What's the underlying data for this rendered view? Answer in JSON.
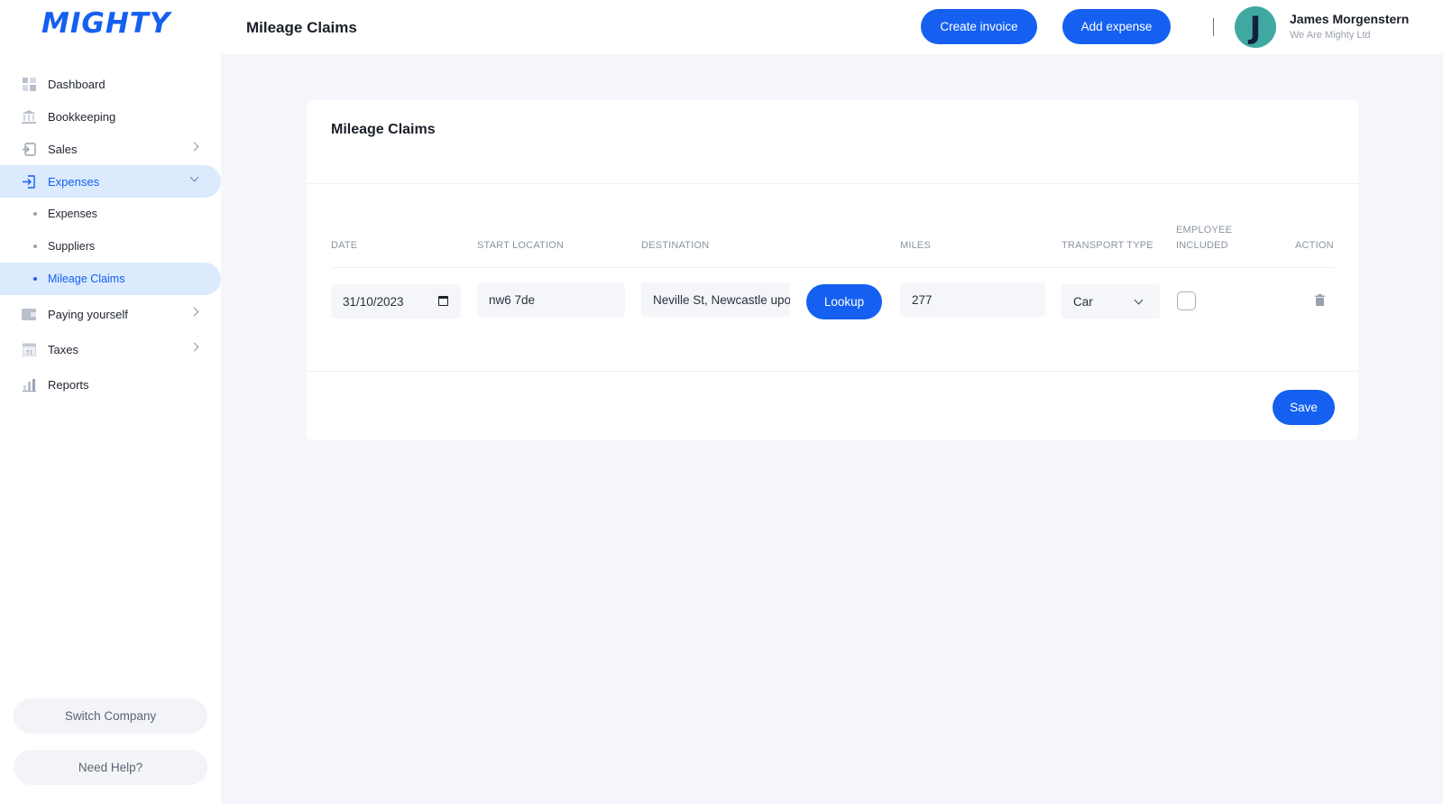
{
  "brand": {
    "logo": "MIGHTY",
    "accent": "#1560f0"
  },
  "sidebar": {
    "items": [
      {
        "label": "Dashboard",
        "icon": "dashboard-icon"
      },
      {
        "label": "Bookkeeping",
        "icon": "bank-icon"
      },
      {
        "label": "Sales",
        "icon": "sales-icon"
      },
      {
        "label": "Expenses",
        "icon": "expenses-icon"
      },
      {
        "label": "Paying yourself",
        "icon": "wallet-icon"
      },
      {
        "label": "Taxes",
        "icon": "calendar-icon",
        "icon_text": "31"
      },
      {
        "label": "Reports",
        "icon": "reports-icon"
      }
    ],
    "expenses_sub": [
      "Expenses",
      "Suppliers",
      "Mileage Claims"
    ],
    "switch_company": "Switch Company",
    "need_help": "Need Help?"
  },
  "header": {
    "title": "Mileage Claims",
    "create_invoice": "Create invoice",
    "add_expense": "Add expense",
    "avatar_initial": "J",
    "user_name": "James Morgenstern",
    "user_company": "We Are Mighty Ltd"
  },
  "card": {
    "title": "Mileage Claims",
    "columns": {
      "date": "DATE",
      "start": "START LOCATION",
      "destination": "DESTINATION",
      "miles": "MILES",
      "transport": "TRANSPORT TYPE",
      "employee_1": "EMPLOYEE",
      "employee_2": "INCLUDED",
      "action": "ACTION"
    },
    "row": {
      "date": "31/10/2023",
      "start": "nw6 7de",
      "destination": "Neville St, Newcastle upon Tyne",
      "lookup": "Lookup",
      "miles": "277",
      "transport": "Car",
      "employee_included": false
    },
    "save": "Save"
  }
}
